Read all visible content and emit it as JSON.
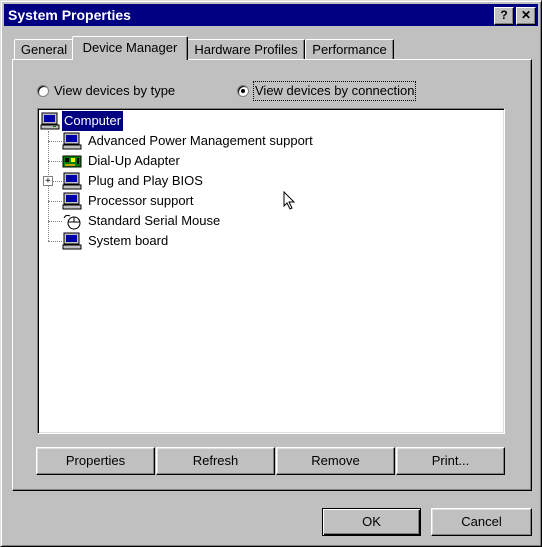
{
  "window": {
    "title": "System Properties",
    "help_button": "?",
    "close_button": "✕"
  },
  "tabs": [
    {
      "label": "General"
    },
    {
      "label": "Device Manager"
    },
    {
      "label": "Hardware Profiles"
    },
    {
      "label": "Performance"
    }
  ],
  "view_options": {
    "by_type": {
      "label": "View devices by type",
      "selected": false
    },
    "by_connection": {
      "label": "View devices by connection",
      "selected": true
    }
  },
  "device_tree": {
    "root": {
      "label": "Computer",
      "icon": "computer-icon",
      "selected": true
    },
    "children": [
      {
        "label": "Advanced Power Management support",
        "icon": "computer-icon",
        "expandable": false
      },
      {
        "label": "Dial-Up Adapter",
        "icon": "network-adapter-icon",
        "expandable": false
      },
      {
        "label": "Plug and Play BIOS",
        "icon": "computer-icon",
        "expandable": true
      },
      {
        "label": "Processor support",
        "icon": "computer-icon",
        "expandable": false
      },
      {
        "label": "Standard Serial Mouse",
        "icon": "mouse-icon",
        "expandable": false
      },
      {
        "label": "System board",
        "icon": "computer-icon",
        "expandable": false
      }
    ]
  },
  "actions": {
    "properties": "Properties",
    "refresh": "Refresh",
    "remove": "Remove",
    "print": "Print..."
  },
  "dialog_buttons": {
    "ok": "OK",
    "cancel": "Cancel"
  }
}
